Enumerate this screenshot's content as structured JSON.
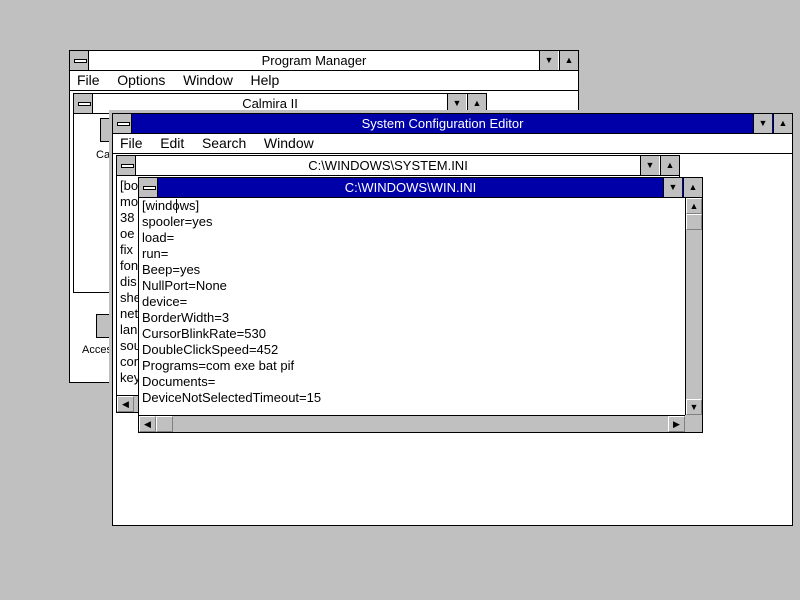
{
  "program_manager": {
    "title": "Program Manager",
    "menu": [
      "File",
      "Options",
      "Window",
      "Help"
    ],
    "calmira_group": {
      "title": "Calmira II",
      "icon_label": "Cal"
    },
    "accessories_label": "Acces"
  },
  "sysedit": {
    "title": "System Configuration Editor",
    "menu": [
      "File",
      "Edit",
      "Search",
      "Window"
    ],
    "system_ini": {
      "title": "C:\\WINDOWS\\SYSTEM.INI",
      "partial_lines": [
        "[bo",
        "mo",
        "38",
        "oe",
        "fix",
        "fon",
        "dis",
        "she",
        "net",
        "lan",
        "sou",
        "cor",
        "key"
      ]
    },
    "win_ini": {
      "title": "C:\\WINDOWS\\WIN.INI",
      "lines": [
        "[windows]",
        "spooler=yes",
        "load=",
        "run=",
        "Beep=yes",
        "NullPort=None",
        "device=",
        "BorderWidth=3",
        "CursorBlinkRate=530",
        "DoubleClickSpeed=452",
        "Programs=com exe bat pif",
        "Documents=",
        "DeviceNotSelectedTimeout=15"
      ]
    }
  },
  "colors": {
    "desktop": "#c0c0c0",
    "active_title": "#0000a8",
    "window_bg": "#ffffff"
  }
}
